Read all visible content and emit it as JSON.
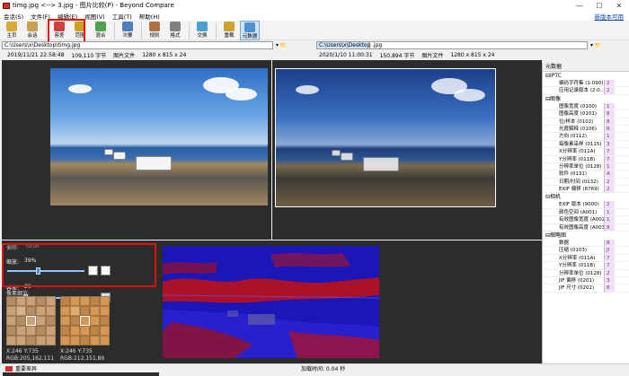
{
  "window": {
    "title": "timg.jpg <--> 3.jpg - 图片比较(P) - Beyond Compare",
    "minimize": "—",
    "maximize": "☐",
    "close": "✕"
  },
  "menu": [
    "会话(S)",
    "文件(F)",
    "编辑(E)",
    "视图(V)",
    "工具(T)",
    "帮助(H)"
  ],
  "newversion": "新版本可用",
  "toolbar": [
    {
      "label": "主页",
      "icon": "home-icon",
      "color": "#d9a93a"
    },
    {
      "label": "会话",
      "icon": "sessions-icon",
      "color": "#c8a050"
    },
    {
      "label": "容差",
      "icon": "tolerance-icon",
      "color": "#d04040"
    },
    {
      "label": "范围",
      "icon": "range-icon",
      "color": "#d0a020"
    },
    {
      "label": "混合",
      "icon": "blend-icon",
      "color": "#50a050"
    },
    {
      "label": "次要",
      "icon": "minor-icon",
      "color": "#4a7fc0"
    },
    {
      "label": "规则",
      "icon": "rules-icon",
      "color": "#b07040"
    },
    {
      "label": "格式",
      "icon": "format-icon",
      "color": "#808080"
    },
    {
      "label": "交换",
      "icon": "swap-icon",
      "color": "#4aa0d0"
    },
    {
      "label": "重载",
      "icon": "reload-icon",
      "color": "#d0a030"
    },
    {
      "label": "元数据",
      "icon": "metadata-icon",
      "color": "#5090d0"
    }
  ],
  "left": {
    "path": "C:\\Users\\x\\Desktop\\timg.jpg",
    "date": "2019/11/21 22:58:48",
    "size": "109,110 字节",
    "type": "图片文件",
    "dims": "1280 x 815 x 24"
  },
  "right": {
    "path": "C:\\Users\\x\\Desktop\\",
    "path_ext": ".jpg",
    "date": "2020/1/10 11:00:31",
    "size": "150,894 字节",
    "type": "图片文件",
    "dims": "1280 x 815 x 24"
  },
  "controls": {
    "offset_label": "偏移:",
    "offset_value": "(0,0)",
    "zoom_label": "缩放:",
    "zoom_value": "39%",
    "zoom_fraction": 0.39,
    "one_to_one": "1:1",
    "tolerance_label": "容差:",
    "tolerance_value": "26",
    "tolerance_fraction": 0.2,
    "pixel_detail_label": "像素细节:"
  },
  "pixels": [
    {
      "xy": "X:246 Y:735",
      "rgb": "RGB:205,162,111"
    },
    {
      "xy": "X:246 Y:735",
      "rgb": "RGB:212,151,86"
    }
  ],
  "metadata": {
    "title": "元数据",
    "groups": [
      {
        "name": "IPTC",
        "items": [
          {
            "n": "编码字符集 (1:090)",
            "v": "2"
          },
          {
            "n": "应用记录版本 (2:0…",
            "v": "2"
          }
        ]
      },
      {
        "name": "图像",
        "items": [
          {
            "n": "图像宽度 (0100)",
            "v": "1"
          },
          {
            "n": "图像高度 (0101)",
            "v": "8"
          },
          {
            "n": "位/样本 (0102)",
            "v": "8"
          },
          {
            "n": "光度解释 (0106)",
            "v": "R"
          },
          {
            "n": "方向 (0112)",
            "v": "1"
          },
          {
            "n": "每像素采样 (0115)",
            "v": "3"
          },
          {
            "n": "X分辨率 (011A)",
            "v": "7"
          },
          {
            "n": "Y分辨率 (011B)",
            "v": "7"
          },
          {
            "n": "分辨率单位 (0128)",
            "v": "1"
          },
          {
            "n": "软件 (0131)",
            "v": "A"
          },
          {
            "n": "日期/时间 (0132)",
            "v": "2"
          },
          {
            "n": "EXIF 偏移 (8769)",
            "v": "2"
          }
        ]
      },
      {
        "name": "相机",
        "items": [
          {
            "n": "EXIF 版本 (9000)",
            "v": "2"
          },
          {
            "n": "颜色空间 (A001)",
            "v": "1"
          },
          {
            "n": "有效图像宽度 (A002)",
            "v": "1"
          },
          {
            "n": "有效图像高度 (A003)",
            "v": "8"
          }
        ]
      },
      {
        "name": "缩略图",
        "items": [
          {
            "n": "数据",
            "v": "B"
          },
          {
            "n": "压缩 (0103)",
            "v": "JI"
          },
          {
            "n": "X分辨率 (011A)",
            "v": "7"
          },
          {
            "n": "Y分辨率 (011B)",
            "v": "7"
          },
          {
            "n": "分辨率单位 (0128)",
            "v": "2"
          },
          {
            "n": "JIF 偏移 (0201)",
            "v": "3"
          },
          {
            "n": "JIF 尺寸 (0202)",
            "v": "8"
          }
        ]
      }
    ]
  },
  "status": {
    "diff": "重要差异",
    "load_time": "加载时间: 0.04 秒"
  }
}
